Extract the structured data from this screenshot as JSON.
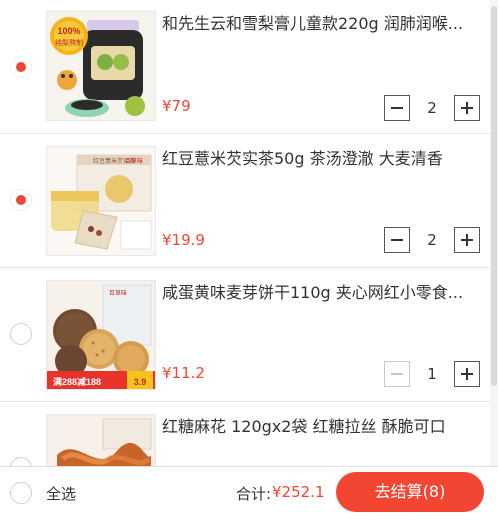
{
  "cart": {
    "items": [
      {
        "title": "和先生云和雪梨膏儿童款220g 润肺润喉...",
        "price": "¥79",
        "qty": "2",
        "checked": true
      },
      {
        "title": "红豆薏米芡实茶50g 茶汤澄澈 大麦清香",
        "price": "¥19.9",
        "qty": "2",
        "checked": true
      },
      {
        "title": "咸蛋黄味麦芽饼干110g 夹心网红小零食...",
        "price": "¥11.2",
        "qty": "1",
        "checked": false
      },
      {
        "title": "红糖麻花 120gx2袋 红糖拉丝 酥脆可口",
        "price": "",
        "qty": "",
        "checked": false
      }
    ],
    "img1": {
      "badge_top": "100%",
      "badge_bottom": "纯梨熬制"
    },
    "img2": {
      "box_text": "红豆薏米芡实茶",
      "brand": "百草味"
    },
    "img3": {
      "brand": "百草味",
      "promo": "满288减188",
      "promo_price": "3.9"
    }
  },
  "footer": {
    "select_all": "全选",
    "total_label": "合计:",
    "total_value": "¥252.1",
    "checkout": "去结算(8)"
  },
  "colors": {
    "accent": "#f24633"
  }
}
